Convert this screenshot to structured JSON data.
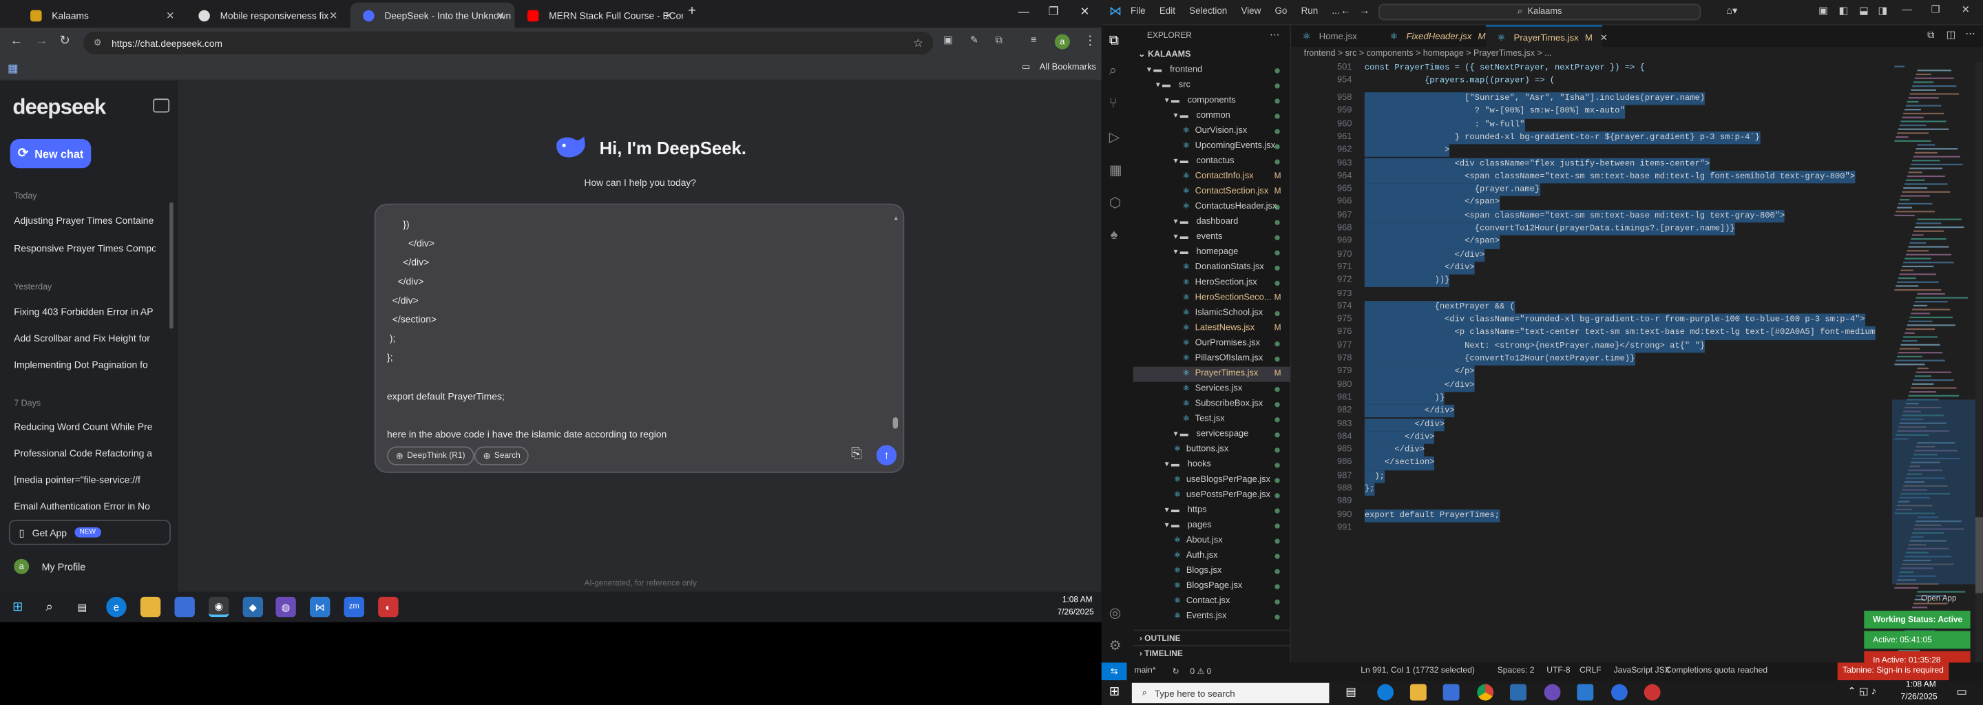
{
  "colors": {
    "accent_blue": "#4d6bfe",
    "vscode_accent": "#0078d4",
    "green": "#2ea043",
    "red": "#c42b1c",
    "chrome_bg": "#202124"
  },
  "browser": {
    "tabs": [
      {
        "title": "Kalaams",
        "icon": "kalaams-favicon"
      },
      {
        "title": "Mobile responsiveness fix",
        "icon": "github-favicon"
      },
      {
        "title": "DeepSeek - Into the Unknown",
        "icon": "deepseek-favicon"
      },
      {
        "title": "MERN Stack Full Course - ECom",
        "icon": "youtube-favicon"
      }
    ],
    "url": "https://chat.deepseek.com",
    "all_bookmarks": "All Bookmarks"
  },
  "deepseek": {
    "logo": "deepseek",
    "new_chat": "New chat",
    "groups": [
      {
        "label": "Today",
        "items": [
          "Adjusting Prayer Times Containe",
          "Responsive Prayer Times Compo"
        ]
      },
      {
        "label": "Yesterday",
        "items": [
          "Fixing 403 Forbidden Error in AP",
          "Add Scrollbar and Fix Height for",
          "Implementing Dot Pagination fo"
        ]
      },
      {
        "label": "7 Days",
        "items": [
          "Reducing Word Count While Pre",
          "Professional Code Refactoring a",
          "[media pointer=\"file-service://f",
          "Email Authentication Error in No"
        ]
      }
    ],
    "get_app": "Get App",
    "new_badge": "NEW",
    "profile": "My Profile",
    "avatar_letter": "a",
    "hero_title": "Hi, I'm DeepSeek.",
    "hero_subtitle": "How can I help you today?",
    "input_lines": [
      "      })",
      "        </div>",
      "      </div>",
      "    </div>",
      "  </div>",
      "  </section>",
      " );",
      "};",
      "",
      "export default PrayerTimes;",
      "",
      "here in the above code i have the islamic date according to region"
    ],
    "deepthink": "DeepThink (R1)",
    "search": "Search",
    "footer": "AI-generated, for reference only"
  },
  "taskbar": {
    "time": "1:08 AM",
    "date": "7/26/2025",
    "search_placeholder": "Type here to search"
  },
  "vscode": {
    "menu": [
      "File",
      "Edit",
      "Selection",
      "View",
      "Go",
      "Run",
      "..."
    ],
    "search": "Kalaams",
    "explorer_title": "EXPLORER",
    "project": "KALAAMS",
    "tree": [
      {
        "label": "frontend",
        "depth": 1,
        "type": "folder",
        "mark": ""
      },
      {
        "label": "src",
        "depth": 2,
        "type": "folder",
        "mark": ""
      },
      {
        "label": "components",
        "depth": 3,
        "type": "folder",
        "mark": ""
      },
      {
        "label": "common",
        "depth": 4,
        "type": "folder",
        "mark": ""
      },
      {
        "label": "OurVision.jsx",
        "depth": 5,
        "type": "file",
        "mark": ""
      },
      {
        "label": "UpcomingEvents.jsx",
        "depth": 5,
        "type": "file",
        "mark": ""
      },
      {
        "label": "contactus",
        "depth": 4,
        "type": "folder",
        "mark": ""
      },
      {
        "label": "ContactInfo.jsx",
        "depth": 5,
        "type": "file",
        "mark": "M"
      },
      {
        "label": "ContactSection.jsx",
        "depth": 5,
        "type": "file",
        "mark": "M"
      },
      {
        "label": "ContactusHeader.jsx",
        "depth": 5,
        "type": "file",
        "mark": ""
      },
      {
        "label": "dashboard",
        "depth": 4,
        "type": "folder",
        "mark": ""
      },
      {
        "label": "events",
        "depth": 4,
        "type": "folder",
        "mark": ""
      },
      {
        "label": "homepage",
        "depth": 4,
        "type": "folder",
        "mark": ""
      },
      {
        "label": "DonationStats.jsx",
        "depth": 5,
        "type": "file",
        "mark": ""
      },
      {
        "label": "HeroSection.jsx",
        "depth": 5,
        "type": "file",
        "mark": ""
      },
      {
        "label": "HeroSectionSeco...",
        "depth": 5,
        "type": "file",
        "mark": "M"
      },
      {
        "label": "IslamicSchool.jsx",
        "depth": 5,
        "type": "file",
        "mark": ""
      },
      {
        "label": "LatestNews.jsx",
        "depth": 5,
        "type": "file",
        "mark": "M"
      },
      {
        "label": "OurPromises.jsx",
        "depth": 5,
        "type": "file",
        "mark": ""
      },
      {
        "label": "PillarsOfIslam.jsx",
        "depth": 5,
        "type": "file",
        "mark": ""
      },
      {
        "label": "PrayerTimes.jsx",
        "depth": 5,
        "type": "file",
        "mark": "M"
      },
      {
        "label": "Services.jsx",
        "depth": 5,
        "type": "file",
        "mark": ""
      },
      {
        "label": "SubscribeBox.jsx",
        "depth": 5,
        "type": "file",
        "mark": ""
      },
      {
        "label": "Test.jsx",
        "depth": 5,
        "type": "file",
        "mark": ""
      },
      {
        "label": "servicespage",
        "depth": 4,
        "type": "folder",
        "mark": ""
      },
      {
        "label": "buttons.jsx",
        "depth": 4,
        "type": "file",
        "mark": ""
      },
      {
        "label": "hooks",
        "depth": 3,
        "type": "folder",
        "mark": ""
      },
      {
        "label": "useBlogsPerPage.jsx",
        "depth": 4,
        "type": "file",
        "mark": ""
      },
      {
        "label": "usePostsPerPage.jsx",
        "depth": 4,
        "type": "file",
        "mark": ""
      },
      {
        "label": "https",
        "depth": 3,
        "type": "folder",
        "mark": ""
      },
      {
        "label": "pages",
        "depth": 3,
        "type": "folder",
        "mark": ""
      },
      {
        "label": "About.jsx",
        "depth": 4,
        "type": "file",
        "mark": ""
      },
      {
        "label": "Auth.jsx",
        "depth": 4,
        "type": "file",
        "mark": ""
      },
      {
        "label": "Blogs.jsx",
        "depth": 4,
        "type": "file",
        "mark": ""
      },
      {
        "label": "BlogsPage.jsx",
        "depth": 4,
        "type": "file",
        "mark": ""
      },
      {
        "label": "Contact.jsx",
        "depth": 4,
        "type": "file",
        "mark": ""
      },
      {
        "label": "Events.jsx",
        "depth": 4,
        "type": "file",
        "mark": ""
      }
    ],
    "outline": "OUTLINE",
    "timeline": "TIMELINE",
    "editor_tabs": [
      {
        "label": "Home.jsx",
        "mark": ""
      },
      {
        "label": "FixedHeader.jsx",
        "mark": "M"
      },
      {
        "label": "PrayerTimes.jsx",
        "mark": "M"
      }
    ],
    "breadcrumb": "frontend > src > components > homepage > PrayerTimes.jsx > ...",
    "sticky_lines": [
      {
        "n": "501",
        "code": "const PrayerTimes = ({ setNextPrayer, nextPrayer }) => {"
      },
      {
        "n": "954",
        "code": "            {prayers.map((prayer) => ("
      }
    ],
    "code_lines": [
      {
        "n": "958",
        "code": "                    [\"Sunrise\", \"Asr\", \"Isha\"].includes(prayer.name)"
      },
      {
        "n": "959",
        "code": "                      ? \"w-[90%] sm:w-[80%] mx-auto\""
      },
      {
        "n": "960",
        "code": "                      : \"w-full\""
      },
      {
        "n": "961",
        "code": "                  } rounded-xl bg-gradient-to-r ${prayer.gradient} p-3 sm:p-4`}"
      },
      {
        "n": "962",
        "code": "                >"
      },
      {
        "n": "963",
        "code": "                  <div className=\"flex justify-between items-center\">"
      },
      {
        "n": "964",
        "code": "                    <span className=\"text-sm sm:text-base md:text-lg font-semibold text-gray-800\">"
      },
      {
        "n": "965",
        "code": "                      {prayer.name}"
      },
      {
        "n": "966",
        "code": "                    </span>"
      },
      {
        "n": "967",
        "code": "                    <span className=\"text-sm sm:text-base md:text-lg text-gray-800\">"
      },
      {
        "n": "968",
        "code": "                      {convertTo12Hour(prayerData.timings?.[prayer.name])}"
      },
      {
        "n": "969",
        "code": "                    </span>"
      },
      {
        "n": "970",
        "code": "                  </div>"
      },
      {
        "n": "971",
        "code": "                </div>"
      },
      {
        "n": "972",
        "code": "              ))}"
      },
      {
        "n": "973",
        "code": ""
      },
      {
        "n": "974",
        "code": "              {nextPrayer && ("
      },
      {
        "n": "975",
        "code": "                <div className=\"rounded-xl bg-gradient-to-r from-purple-100 to-blue-100 p-3 sm:p-4\">"
      },
      {
        "n": "976",
        "code": "                  <p className=\"text-center text-sm sm:text-base md:text-lg text-[#02A0A5] font-medium"
      },
      {
        "n": "977",
        "code": "                    Next: <strong>{nextPrayer.name}</strong> at{\" \"}"
      },
      {
        "n": "978",
        "code": "                    {convertTo12Hour(nextPrayer.time)}"
      },
      {
        "n": "979",
        "code": "                  </p>"
      },
      {
        "n": "980",
        "code": "                </div>"
      },
      {
        "n": "981",
        "code": "              )}"
      },
      {
        "n": "982",
        "code": "            </div>"
      },
      {
        "n": "983",
        "code": "          </div>"
      },
      {
        "n": "984",
        "code": "        </div>"
      },
      {
        "n": "985",
        "code": "      </div>"
      },
      {
        "n": "986",
        "code": "    </section>"
      },
      {
        "n": "987",
        "code": "  );"
      },
      {
        "n": "988",
        "code": "};"
      },
      {
        "n": "989",
        "code": ""
      },
      {
        "n": "990",
        "code": "export default PrayerTimes;"
      },
      {
        "n": "991",
        "code": ""
      }
    ],
    "open_app": "Open App",
    "working_status": "Working Status: Active",
    "active_time": "Active: 05:41:05",
    "inactive_time": "In Active: 01:35:28",
    "status_left": [
      "main*",
      "0 ⚠ 0"
    ],
    "status_right": [
      "Ln 991, Col 1 (17732 selected)",
      "Spaces: 2",
      "UTF-8",
      "CRLF",
      "JavaScript JSX",
      "Completions quota reached",
      "Tabnine: Sign-in is required"
    ]
  }
}
